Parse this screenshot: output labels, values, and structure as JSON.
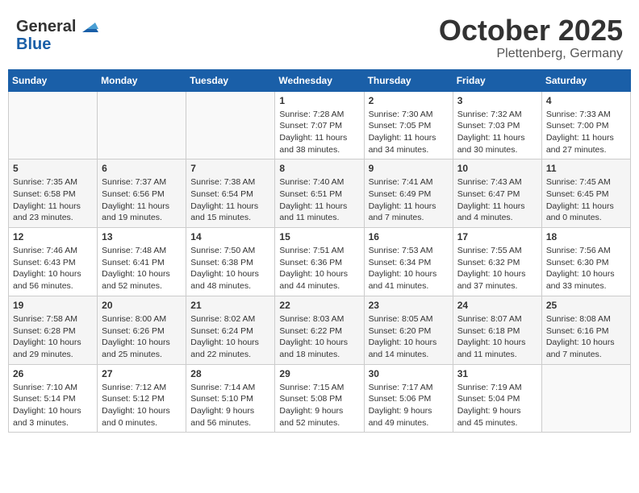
{
  "header": {
    "logo_general": "General",
    "logo_blue": "Blue",
    "month": "October 2025",
    "location": "Plettenberg, Germany"
  },
  "weekdays": [
    "Sunday",
    "Monday",
    "Tuesday",
    "Wednesday",
    "Thursday",
    "Friday",
    "Saturday"
  ],
  "weeks": [
    [
      {
        "day": "",
        "sunrise": "",
        "sunset": "",
        "daylight": ""
      },
      {
        "day": "",
        "sunrise": "",
        "sunset": "",
        "daylight": ""
      },
      {
        "day": "",
        "sunrise": "",
        "sunset": "",
        "daylight": ""
      },
      {
        "day": "1",
        "sunrise": "Sunrise: 7:28 AM",
        "sunset": "Sunset: 7:07 PM",
        "daylight": "Daylight: 11 hours and 38 minutes."
      },
      {
        "day": "2",
        "sunrise": "Sunrise: 7:30 AM",
        "sunset": "Sunset: 7:05 PM",
        "daylight": "Daylight: 11 hours and 34 minutes."
      },
      {
        "day": "3",
        "sunrise": "Sunrise: 7:32 AM",
        "sunset": "Sunset: 7:03 PM",
        "daylight": "Daylight: 11 hours and 30 minutes."
      },
      {
        "day": "4",
        "sunrise": "Sunrise: 7:33 AM",
        "sunset": "Sunset: 7:00 PM",
        "daylight": "Daylight: 11 hours and 27 minutes."
      }
    ],
    [
      {
        "day": "5",
        "sunrise": "Sunrise: 7:35 AM",
        "sunset": "Sunset: 6:58 PM",
        "daylight": "Daylight: 11 hours and 23 minutes."
      },
      {
        "day": "6",
        "sunrise": "Sunrise: 7:37 AM",
        "sunset": "Sunset: 6:56 PM",
        "daylight": "Daylight: 11 hours and 19 minutes."
      },
      {
        "day": "7",
        "sunrise": "Sunrise: 7:38 AM",
        "sunset": "Sunset: 6:54 PM",
        "daylight": "Daylight: 11 hours and 15 minutes."
      },
      {
        "day": "8",
        "sunrise": "Sunrise: 7:40 AM",
        "sunset": "Sunset: 6:51 PM",
        "daylight": "Daylight: 11 hours and 11 minutes."
      },
      {
        "day": "9",
        "sunrise": "Sunrise: 7:41 AM",
        "sunset": "Sunset: 6:49 PM",
        "daylight": "Daylight: 11 hours and 7 minutes."
      },
      {
        "day": "10",
        "sunrise": "Sunrise: 7:43 AM",
        "sunset": "Sunset: 6:47 PM",
        "daylight": "Daylight: 11 hours and 4 minutes."
      },
      {
        "day": "11",
        "sunrise": "Sunrise: 7:45 AM",
        "sunset": "Sunset: 6:45 PM",
        "daylight": "Daylight: 11 hours and 0 minutes."
      }
    ],
    [
      {
        "day": "12",
        "sunrise": "Sunrise: 7:46 AM",
        "sunset": "Sunset: 6:43 PM",
        "daylight": "Daylight: 10 hours and 56 minutes."
      },
      {
        "day": "13",
        "sunrise": "Sunrise: 7:48 AM",
        "sunset": "Sunset: 6:41 PM",
        "daylight": "Daylight: 10 hours and 52 minutes."
      },
      {
        "day": "14",
        "sunrise": "Sunrise: 7:50 AM",
        "sunset": "Sunset: 6:38 PM",
        "daylight": "Daylight: 10 hours and 48 minutes."
      },
      {
        "day": "15",
        "sunrise": "Sunrise: 7:51 AM",
        "sunset": "Sunset: 6:36 PM",
        "daylight": "Daylight: 10 hours and 44 minutes."
      },
      {
        "day": "16",
        "sunrise": "Sunrise: 7:53 AM",
        "sunset": "Sunset: 6:34 PM",
        "daylight": "Daylight: 10 hours and 41 minutes."
      },
      {
        "day": "17",
        "sunrise": "Sunrise: 7:55 AM",
        "sunset": "Sunset: 6:32 PM",
        "daylight": "Daylight: 10 hours and 37 minutes."
      },
      {
        "day": "18",
        "sunrise": "Sunrise: 7:56 AM",
        "sunset": "Sunset: 6:30 PM",
        "daylight": "Daylight: 10 hours and 33 minutes."
      }
    ],
    [
      {
        "day": "19",
        "sunrise": "Sunrise: 7:58 AM",
        "sunset": "Sunset: 6:28 PM",
        "daylight": "Daylight: 10 hours and 29 minutes."
      },
      {
        "day": "20",
        "sunrise": "Sunrise: 8:00 AM",
        "sunset": "Sunset: 6:26 PM",
        "daylight": "Daylight: 10 hours and 25 minutes."
      },
      {
        "day": "21",
        "sunrise": "Sunrise: 8:02 AM",
        "sunset": "Sunset: 6:24 PM",
        "daylight": "Daylight: 10 hours and 22 minutes."
      },
      {
        "day": "22",
        "sunrise": "Sunrise: 8:03 AM",
        "sunset": "Sunset: 6:22 PM",
        "daylight": "Daylight: 10 hours and 18 minutes."
      },
      {
        "day": "23",
        "sunrise": "Sunrise: 8:05 AM",
        "sunset": "Sunset: 6:20 PM",
        "daylight": "Daylight: 10 hours and 14 minutes."
      },
      {
        "day": "24",
        "sunrise": "Sunrise: 8:07 AM",
        "sunset": "Sunset: 6:18 PM",
        "daylight": "Daylight: 10 hours and 11 minutes."
      },
      {
        "day": "25",
        "sunrise": "Sunrise: 8:08 AM",
        "sunset": "Sunset: 6:16 PM",
        "daylight": "Daylight: 10 hours and 7 minutes."
      }
    ],
    [
      {
        "day": "26",
        "sunrise": "Sunrise: 7:10 AM",
        "sunset": "Sunset: 5:14 PM",
        "daylight": "Daylight: 10 hours and 3 minutes."
      },
      {
        "day": "27",
        "sunrise": "Sunrise: 7:12 AM",
        "sunset": "Sunset: 5:12 PM",
        "daylight": "Daylight: 10 hours and 0 minutes."
      },
      {
        "day": "28",
        "sunrise": "Sunrise: 7:14 AM",
        "sunset": "Sunset: 5:10 PM",
        "daylight": "Daylight: 9 hours and 56 minutes."
      },
      {
        "day": "29",
        "sunrise": "Sunrise: 7:15 AM",
        "sunset": "Sunset: 5:08 PM",
        "daylight": "Daylight: 9 hours and 52 minutes."
      },
      {
        "day": "30",
        "sunrise": "Sunrise: 7:17 AM",
        "sunset": "Sunset: 5:06 PM",
        "daylight": "Daylight: 9 hours and 49 minutes."
      },
      {
        "day": "31",
        "sunrise": "Sunrise: 7:19 AM",
        "sunset": "Sunset: 5:04 PM",
        "daylight": "Daylight: 9 hours and 45 minutes."
      },
      {
        "day": "",
        "sunrise": "",
        "sunset": "",
        "daylight": ""
      }
    ]
  ]
}
